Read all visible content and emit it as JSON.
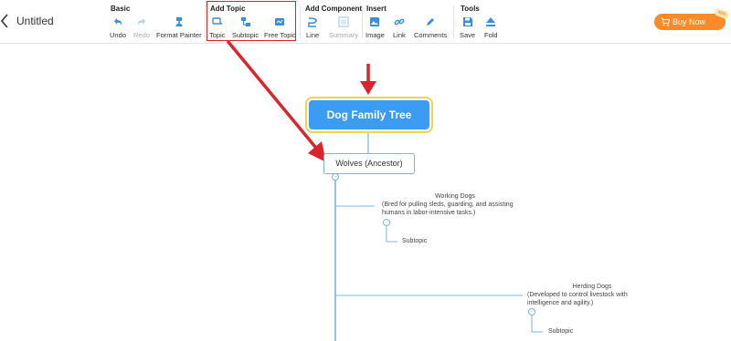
{
  "app": {
    "title": "Untitled"
  },
  "toolbar": {
    "groups": [
      {
        "title": "Basic",
        "tools": [
          {
            "label": "Undo",
            "icon": "undo-icon"
          },
          {
            "label": "Redo",
            "icon": "redo-icon",
            "disabled": true
          },
          {
            "label": "Format Painter",
            "icon": "format-painter-icon"
          }
        ]
      },
      {
        "title": "Add Topic",
        "tools": [
          {
            "label": "Topic",
            "icon": "topic-icon"
          },
          {
            "label": "Subtopic",
            "icon": "subtopic-icon"
          },
          {
            "label": "Free Topic",
            "icon": "free-topic-icon"
          }
        ]
      },
      {
        "title": "Add Component",
        "tools": [
          {
            "label": "Line",
            "icon": "line-icon"
          },
          {
            "label": "Summary",
            "icon": "summary-icon",
            "disabled": true
          }
        ]
      },
      {
        "title": "Insert",
        "tools": [
          {
            "label": "Image",
            "icon": "image-icon"
          },
          {
            "label": "Link",
            "icon": "link-icon"
          },
          {
            "label": "Comments",
            "icon": "comments-icon"
          }
        ]
      },
      {
        "title": "Tools",
        "tools": [
          {
            "label": "Save",
            "icon": "save-icon"
          },
          {
            "label": "Fold",
            "icon": "fold-icon"
          }
        ]
      }
    ],
    "buy_now": "Buy Now",
    "buy_badge": "40%"
  },
  "mindmap": {
    "root": "Dog Family Tree",
    "level1": "Wolves (Ancestor)",
    "branches": [
      {
        "title": "Working Dogs",
        "desc": "(Bred for pulling sleds, guarding, and assisting humans in labor-intensive tasks.)",
        "subtopic": "Subtopic"
      },
      {
        "title": "Herding Dogs",
        "desc": "(Developed to control livestock with intelligence and agility.)",
        "subtopic": "Subtopic"
      }
    ]
  },
  "colors": {
    "accent": "#3b9cf3",
    "highlight": "#d9262c",
    "buy": "#f98b2b"
  }
}
